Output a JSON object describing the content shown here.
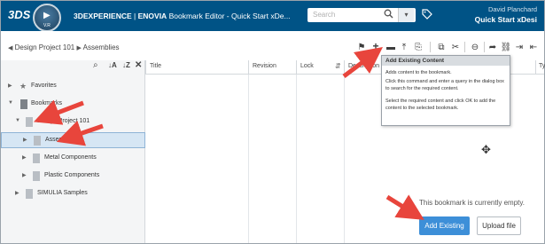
{
  "topbar": {
    "brand_mark": "3DS",
    "compass_version": "V.R",
    "title_brand": "3DEXPERIENCE",
    "title_separator": " | ",
    "title_app": "ENOVIA",
    "title_rest": " Bookmark Editor - Quick Start xDe...",
    "search_placeholder": "Search",
    "user_name": "David Planchard",
    "space_name": "Quick Start xDesi"
  },
  "breadcrumb": {
    "items": [
      "Design Project 101",
      "Assemblies"
    ]
  },
  "toolbar": {
    "icons": [
      "bookmark-flag-icon",
      "add-existing-icon",
      "insert-icon",
      "upload-icon",
      "share-icon",
      "copy-icon",
      "cut-icon",
      "structure-icon",
      "forward-icon",
      "link-icon",
      "import-icon",
      "export-icon"
    ]
  },
  "tooltip": {
    "title": "Add Existing Content",
    "line1": "Adds content to the bookmark.",
    "line2": "Click this command and enter a query in the dialog box to search for the required content.",
    "line3": "Select the required content and click OK to add the content to the selected bookmark."
  },
  "tree": {
    "favorites": "Favorites",
    "bookmarks": "Bookmarks",
    "project": "Design Project 101",
    "assemblies": "Assemblies",
    "metal": "Metal Components",
    "plastic": "Plastic Components",
    "simulia": "SIMULIA Samples"
  },
  "columns": {
    "title": "Title",
    "revision": "Revision",
    "lock": "Lock",
    "description": "Description",
    "type": "Ty"
  },
  "main": {
    "empty_message": "This bookmark is currently empty.",
    "add_existing_label": "Add Existing",
    "upload_file_label": "Upload file"
  },
  "colors": {
    "topbar": "#005386",
    "primary_button": "#3d8fd8",
    "annotation_arrow": "#e8453c",
    "selected_row": "#d6e6f4"
  }
}
